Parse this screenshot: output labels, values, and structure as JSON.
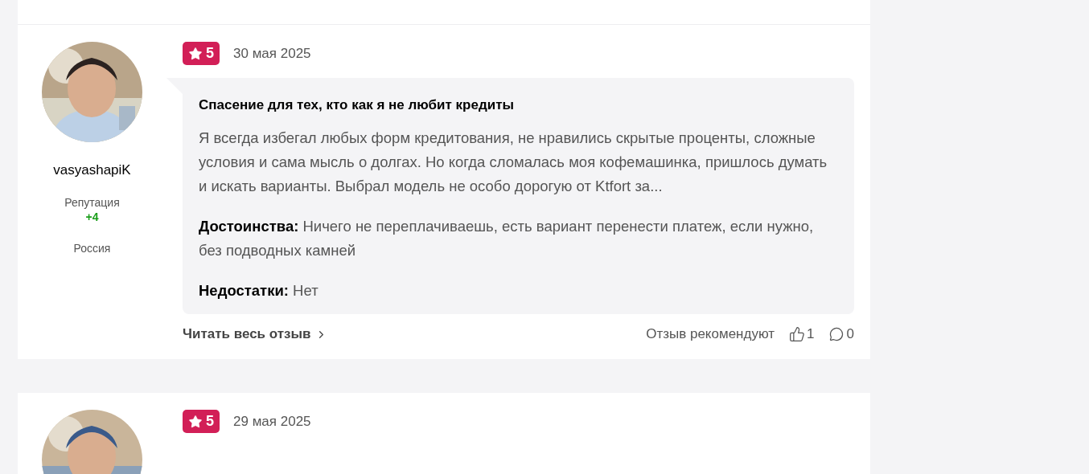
{
  "reviews": [
    {
      "author": {
        "name": "vasyashapiK",
        "reputation_label": "Репутация",
        "reputation": "+4",
        "country": "Россия"
      },
      "rating": "5",
      "date": "30 мая 2025",
      "title": "Спасение для тех, кто как я не любит кредиты",
      "text": "Я всегда избегал любых форм кредитования, не нравились скрытые проценты, сложные условия и сама мысль о долгах. Но когда сломалась моя кофемашинка, пришлось думать и искать варианты. Выбрал модель не особо дорогую от Ktfort за...",
      "pros_label": "Достоинства:",
      "pros": "Ничего не переплачиваешь, есть вариант перенести платеж, если нужно, без подводных камней",
      "cons_label": "Недостатки:",
      "cons": "Нет",
      "footer": {
        "read_more": "Читать весь отзыв",
        "recommend_label": "Отзыв рекомендуют",
        "likes": "1",
        "comments": "0"
      }
    },
    {
      "rating": "5",
      "date": "29 мая 2025"
    }
  ]
}
